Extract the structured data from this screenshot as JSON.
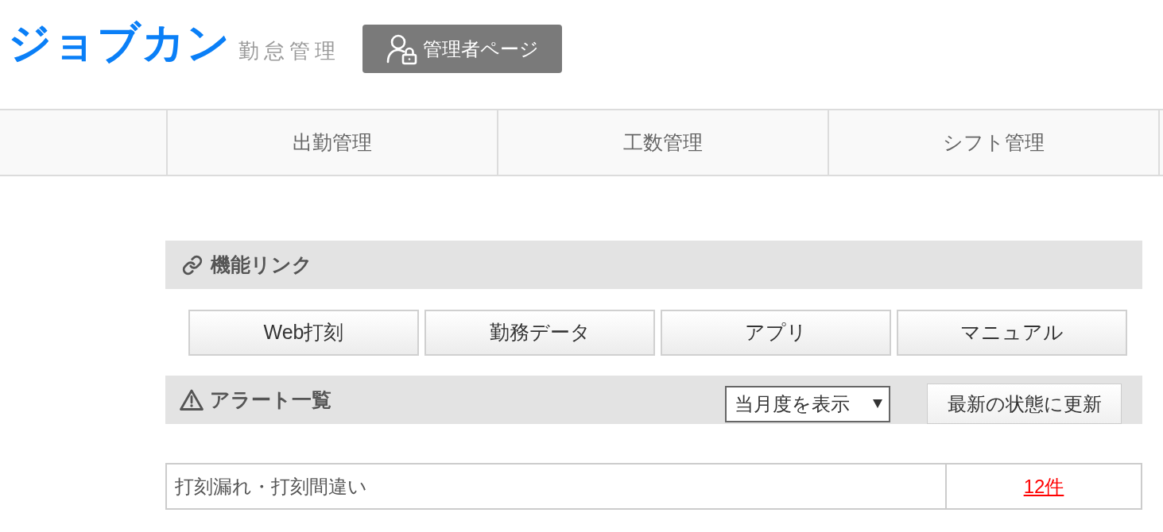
{
  "header": {
    "logo": "ジョブカン",
    "product": "勤怠管理",
    "admin_button": "管理者ページ"
  },
  "nav": {
    "tabs": [
      {
        "label": "出勤管理"
      },
      {
        "label": "工数管理"
      },
      {
        "label": "シフト管理"
      }
    ]
  },
  "function_links": {
    "title": "機能リンク",
    "buttons": [
      "Web打刻",
      "勤務データ",
      "アプリ",
      "マニュアル"
    ]
  },
  "alerts": {
    "title": "アラート一覧",
    "period_select": {
      "value": "当月度を表示"
    },
    "refresh_button": "最新の状態に更新",
    "rows": [
      {
        "label": "打刻漏れ・打刻間違い",
        "count": "12件"
      }
    ]
  }
}
